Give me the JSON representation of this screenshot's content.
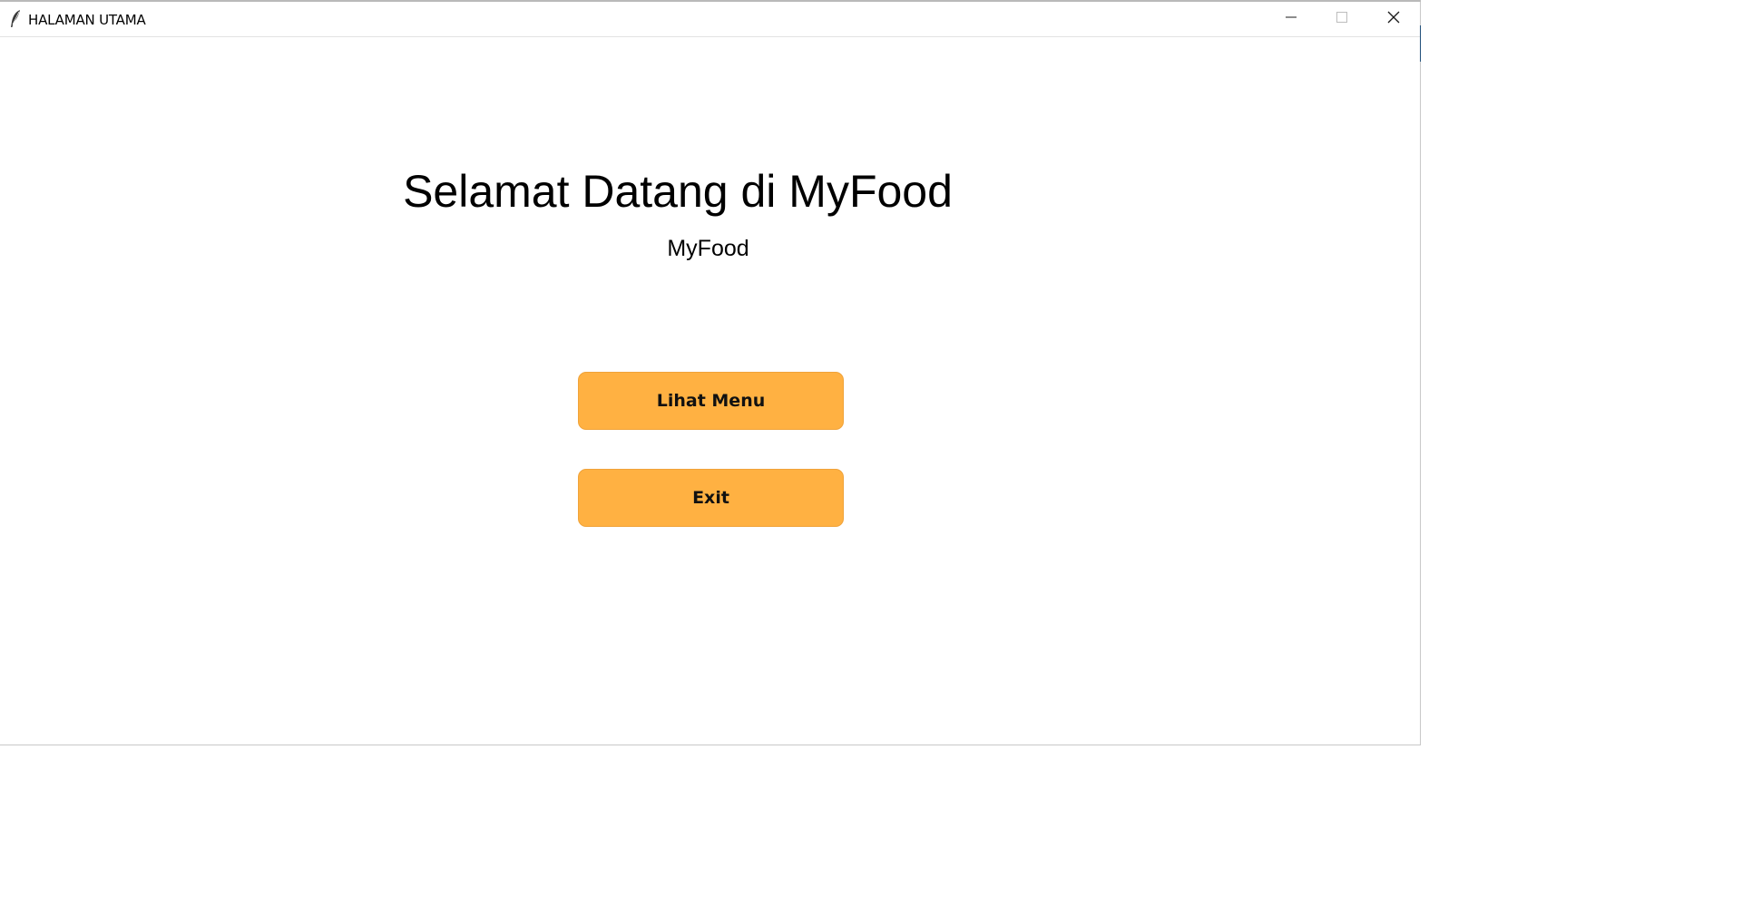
{
  "window": {
    "title": "HALAMAN UTAMA",
    "icon": "feather-icon",
    "controls": {
      "minimize_icon": "minimize-icon",
      "maximize_icon": "maximize-icon",
      "close_icon": "close-icon"
    }
  },
  "main": {
    "heading": "Selamat Datang di MyFood",
    "subtitle": "MyFood",
    "buttons": {
      "menu_label": "Lihat Menu",
      "exit_label": "Exit"
    }
  },
  "colors": {
    "button_bg": "#ffb142",
    "text": "#000000",
    "background": "#ffffff"
  }
}
